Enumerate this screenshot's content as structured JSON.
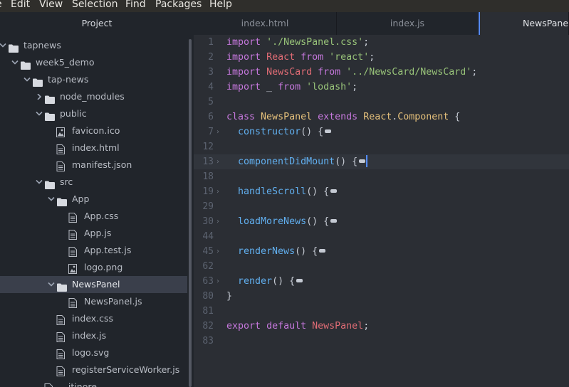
{
  "menu": [
    "e",
    "Edit",
    "View",
    "Selection",
    "Find",
    "Packages",
    "Help"
  ],
  "tree": {
    "header": "Project",
    "items": [
      {
        "label": "tapnews",
        "type": "folder",
        "expanded": true
      },
      {
        "label": "week5_demo",
        "type": "folder",
        "expanded": true
      },
      {
        "label": "tap-news",
        "type": "folder",
        "expanded": true
      },
      {
        "label": "node_modules",
        "type": "folder",
        "expanded": false
      },
      {
        "label": "public",
        "type": "folder",
        "expanded": true
      },
      {
        "label": "favicon.ico",
        "type": "image"
      },
      {
        "label": "index.html",
        "type": "file"
      },
      {
        "label": "manifest.json",
        "type": "file"
      },
      {
        "label": "src",
        "type": "folder",
        "expanded": true
      },
      {
        "label": "App",
        "type": "folder",
        "expanded": true
      },
      {
        "label": "App.css",
        "type": "file"
      },
      {
        "label": "App.js",
        "type": "file"
      },
      {
        "label": "App.test.js",
        "type": "file"
      },
      {
        "label": "logo.png",
        "type": "image"
      },
      {
        "label": "NewsPanel",
        "type": "folder",
        "expanded": true,
        "selected": true
      },
      {
        "label": "NewsPanel.js",
        "type": "file"
      },
      {
        "label": "index.css",
        "type": "file"
      },
      {
        "label": "index.js",
        "type": "file"
      },
      {
        "label": "logo.svg",
        "type": "file"
      },
      {
        "label": "registerServiceWorker.js",
        "type": "file"
      },
      {
        "label": "...itinore",
        "type": "file"
      }
    ]
  },
  "tabs": [
    {
      "label": "index.html",
      "active": false
    },
    {
      "label": "index.js",
      "active": false
    },
    {
      "label": "NewsPanel.js",
      "active": true
    }
  ],
  "editor": {
    "lines": [
      {
        "n": "1",
        "tokens": [
          [
            "kw",
            "import"
          ],
          [
            "plain",
            " "
          ],
          [
            "str",
            "'./NewsPanel.css'"
          ],
          [
            "plain",
            ";"
          ]
        ]
      },
      {
        "n": "2",
        "tokens": [
          [
            "kw",
            "import"
          ],
          [
            "plain",
            " "
          ],
          [
            "var",
            "React"
          ],
          [
            "plain",
            " "
          ],
          [
            "kw",
            "from"
          ],
          [
            "plain",
            " "
          ],
          [
            "str",
            "'react'"
          ],
          [
            "plain",
            ";"
          ]
        ]
      },
      {
        "n": "3",
        "tokens": [
          [
            "kw",
            "import"
          ],
          [
            "plain",
            " "
          ],
          [
            "var",
            "NewsCard"
          ],
          [
            "plain",
            " "
          ],
          [
            "kw",
            "from"
          ],
          [
            "plain",
            " "
          ],
          [
            "str",
            "'../NewsCard/NewsCard'"
          ],
          [
            "plain",
            ";"
          ]
        ]
      },
      {
        "n": "4",
        "tokens": [
          [
            "kw",
            "import"
          ],
          [
            "plain",
            " _ "
          ],
          [
            "kw",
            "from"
          ],
          [
            "plain",
            " "
          ],
          [
            "str",
            "'lodash'"
          ],
          [
            "plain",
            ";"
          ]
        ]
      },
      {
        "n": "5",
        "tokens": []
      },
      {
        "n": "6",
        "tokens": [
          [
            "kw",
            "class"
          ],
          [
            "plain",
            " "
          ],
          [
            "cls",
            "NewsPanel"
          ],
          [
            "plain",
            " "
          ],
          [
            "kw",
            "extends"
          ],
          [
            "plain",
            " "
          ],
          [
            "cls",
            "React"
          ],
          [
            "plain",
            "."
          ],
          [
            "cls",
            "Component"
          ],
          [
            "plain",
            " {"
          ]
        ]
      },
      {
        "n": "7",
        "fold": true,
        "tokens": [
          [
            "plain",
            "  "
          ],
          [
            "fn",
            "constructor"
          ],
          [
            "plain",
            "() {"
          ]
        ],
        "badge": true
      },
      {
        "n": "12",
        "tokens": []
      },
      {
        "n": "13",
        "fold": true,
        "current": true,
        "tokens": [
          [
            "plain",
            "  "
          ],
          [
            "fn",
            "componentDidMount"
          ],
          [
            "plain",
            "() {"
          ]
        ],
        "badge": true,
        "cursor": true
      },
      {
        "n": "18",
        "tokens": []
      },
      {
        "n": "19",
        "fold": true,
        "tokens": [
          [
            "plain",
            "  "
          ],
          [
            "fn",
            "handleScroll"
          ],
          [
            "plain",
            "() {"
          ]
        ],
        "badge": true
      },
      {
        "n": "29",
        "tokens": []
      },
      {
        "n": "30",
        "fold": true,
        "tokens": [
          [
            "plain",
            "  "
          ],
          [
            "fn",
            "loadMoreNews"
          ],
          [
            "plain",
            "() {"
          ]
        ],
        "badge": true
      },
      {
        "n": "44",
        "tokens": []
      },
      {
        "n": "45",
        "fold": true,
        "tokens": [
          [
            "plain",
            "  "
          ],
          [
            "fn",
            "renderNews"
          ],
          [
            "plain",
            "() {"
          ]
        ],
        "badge": true
      },
      {
        "n": "62",
        "tokens": []
      },
      {
        "n": "63",
        "fold": true,
        "tokens": [
          [
            "plain",
            "  "
          ],
          [
            "fn",
            "render"
          ],
          [
            "plain",
            "() {"
          ]
        ],
        "badge": true
      },
      {
        "n": "80",
        "tokens": [
          [
            "plain",
            "}"
          ]
        ]
      },
      {
        "n": "81",
        "tokens": []
      },
      {
        "n": "82",
        "tokens": [
          [
            "kw",
            "export"
          ],
          [
            "plain",
            " "
          ],
          [
            "kw",
            "default"
          ],
          [
            "plain",
            " "
          ],
          [
            "var",
            "NewsPanel"
          ],
          [
            "plain",
            ";"
          ]
        ]
      },
      {
        "n": "83",
        "tokens": []
      }
    ]
  },
  "colors": {
    "keyword": "#c678dd",
    "string": "#98c379",
    "class": "#e5c07b",
    "variable": "#e06c75",
    "function": "#61afef",
    "accent": "#568af2"
  }
}
